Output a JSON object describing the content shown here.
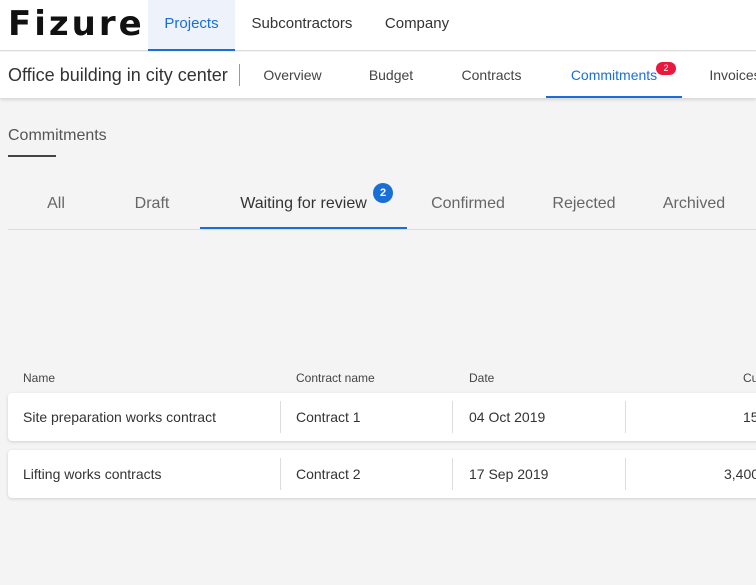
{
  "app": {
    "logo": "Fizure"
  },
  "top_nav": [
    {
      "label": "Projects",
      "active": true
    },
    {
      "label": "Subcontractors",
      "active": false
    },
    {
      "label": "Company",
      "active": false
    }
  ],
  "project": {
    "title": "Office building in city center",
    "tabs": [
      {
        "label": "Overview"
      },
      {
        "label": "Budget"
      },
      {
        "label": "Contracts"
      },
      {
        "label": "Commitments",
        "active": true,
        "badge": "2"
      },
      {
        "label": "Invoices"
      }
    ]
  },
  "section": {
    "title": "Commitments"
  },
  "status_tabs": [
    {
      "label": "All"
    },
    {
      "label": "Draft"
    },
    {
      "label": "Waiting for review",
      "active": true,
      "badge": "2"
    },
    {
      "label": "Confirmed"
    },
    {
      "label": "Rejected"
    },
    {
      "label": "Archived"
    }
  ],
  "table": {
    "headers": [
      "Name",
      "Contract name",
      "Date",
      "Cu"
    ],
    "rows": [
      {
        "name": "Site preparation works contract",
        "contract": "Contract 1",
        "date": "04 Oct 2019",
        "amount": "15"
      },
      {
        "name": "Lifting works contracts",
        "contract": "Contract 2",
        "date": "17 Sep 2019",
        "amount": "3,400"
      }
    ]
  },
  "colors": {
    "accent": "#1a6fd6",
    "badge_red": "#e8193c"
  }
}
